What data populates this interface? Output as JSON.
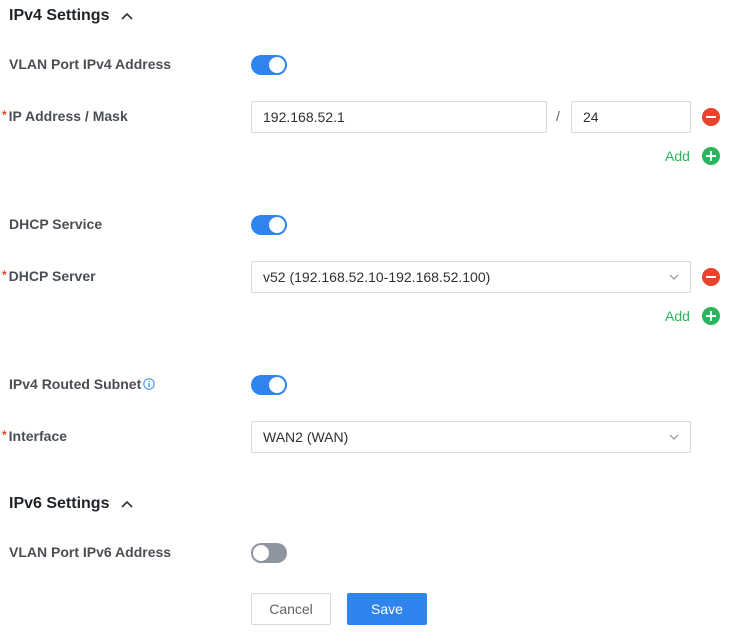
{
  "ipv4": {
    "title": "IPv4 Settings",
    "vlan_port_label": "VLAN Port IPv4 Address",
    "vlan_port_enabled": true,
    "ip_mask_label": "IP Address / Mask",
    "ip_value": "192.168.52.1",
    "slash": "/",
    "mask_value": "24",
    "add_label": "Add",
    "dhcp_service_label": "DHCP Service",
    "dhcp_service_enabled": true,
    "dhcp_server_label": "DHCP Server",
    "dhcp_server_value": "v52 (192.168.52.10-192.168.52.100)",
    "dhcp_add_label": "Add",
    "routed_subnet_label": "IPv4 Routed Subnet",
    "routed_subnet_enabled": true,
    "interface_label": "Interface",
    "interface_value": "WAN2 (WAN)"
  },
  "ipv6": {
    "title": "IPv6 Settings",
    "vlan_port_label": "VLAN Port IPv6 Address",
    "vlan_port_enabled": false
  },
  "required_mark": "*",
  "actions": {
    "cancel_label": "Cancel",
    "save_label": "Save"
  },
  "colors": {
    "accent": "#2f85ed",
    "danger": "#e8432b",
    "success": "#2db55d",
    "toggle_off": "#8f959e"
  }
}
